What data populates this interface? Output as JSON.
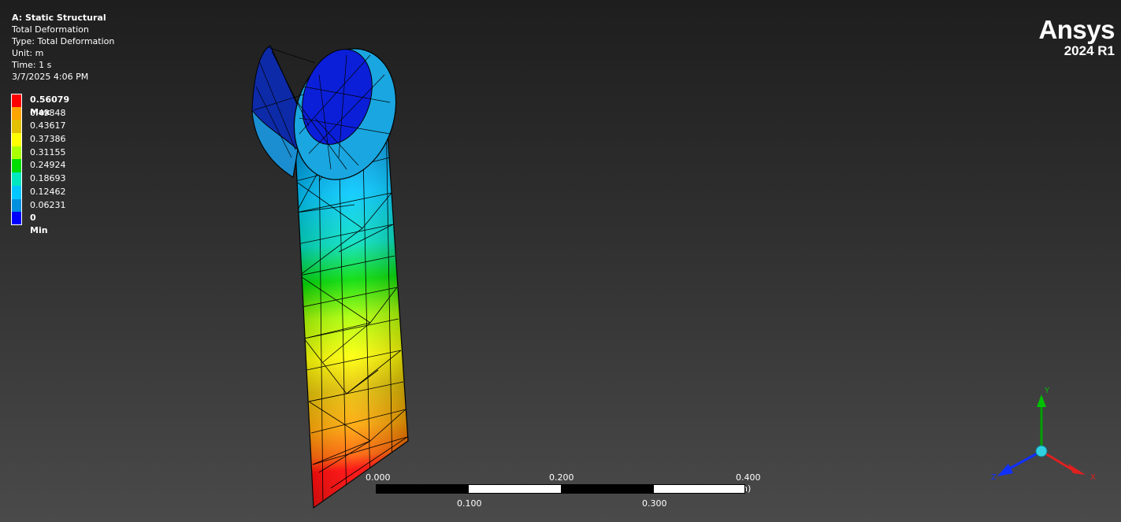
{
  "info": {
    "title": "A: Static Structural",
    "result": "Total Deformation",
    "type": "Type: Total Deformation",
    "unit": "Unit: m",
    "time": "Time: 1 s",
    "date": "3/7/2025 4:06 PM"
  },
  "legend": {
    "items": [
      {
        "label": "0.56079 Max",
        "color": "#ff0000",
        "bold": true
      },
      {
        "label": "0.49848",
        "color": "#ffa500"
      },
      {
        "label": "0.43617",
        "color": "#e3c000"
      },
      {
        "label": "0.37386",
        "color": "#ffff00"
      },
      {
        "label": "0.31155",
        "color": "#aaff00"
      },
      {
        "label": "0.24924",
        "color": "#00dd00"
      },
      {
        "label": "0.18693",
        "color": "#00e8c0"
      },
      {
        "label": "0.12462",
        "color": "#00c8ff"
      },
      {
        "label": "0.06231",
        "color": "#0090e0"
      },
      {
        "label": "0 Min",
        "color": "#0000ff",
        "bold": true
      }
    ]
  },
  "brand": {
    "name": "Ansys",
    "version": "2024 R1"
  },
  "scale_bar": {
    "top_labels": [
      "0.000",
      "0.200",
      "0.400 (m)"
    ],
    "bottom_labels": [
      "0.100",
      "0.300"
    ]
  },
  "triad": {
    "x": "X",
    "y": "Y",
    "z": "Z",
    "x_color": "#e02020",
    "y_color": "#00a000",
    "z_color": "#1030ff"
  }
}
